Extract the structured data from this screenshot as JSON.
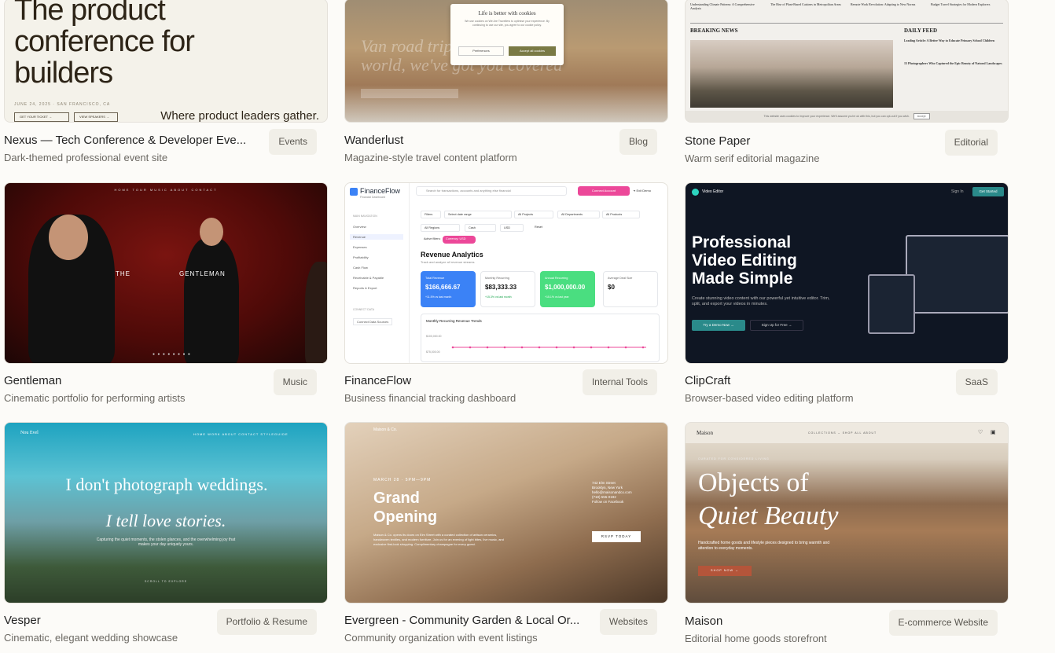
{
  "cards": [
    {
      "title": "Nexus — Tech Conference & Developer Eve...",
      "desc": "Dark-themed professional event site",
      "tag": "Events"
    },
    {
      "title": "Wanderlust",
      "desc": "Magazine-style travel content platform",
      "tag": "Blog"
    },
    {
      "title": "Stone Paper",
      "desc": "Warm serif editorial magazine",
      "tag": "Editorial"
    },
    {
      "title": "Gentleman",
      "desc": "Cinematic portfolio for performing artists",
      "tag": "Music"
    },
    {
      "title": "FinanceFlow",
      "desc": "Business financial tracking dashboard",
      "tag": "Internal Tools"
    },
    {
      "title": "ClipCraft",
      "desc": "Browser-based video editing platform",
      "tag": "SaaS"
    },
    {
      "title": "Vesper",
      "desc": "Cinematic, elegant wedding showcase",
      "tag": "Portfolio & Resume"
    },
    {
      "title": "Evergreen - Community Garden & Local Or...",
      "desc": "Community organization with event listings",
      "tag": "Websites"
    },
    {
      "title": "Maison",
      "desc": "Editorial home goods storefront",
      "tag": "E-commerce Website"
    }
  ],
  "nexus": {
    "headline": "The product conference for builders",
    "subline": "JUNE 24, 2025 · SAN FRANCISCO, CA",
    "btn_ticket": "GET YOUR TICKET →",
    "btn_speakers": "VIEW SPEAKERS →",
    "tagline": "Where product leaders gather."
  },
  "wanderlust": {
    "bg_text": "Van road trips\nworld, we've got you covered",
    "cookie_title": "Life is better with cookies",
    "cookie_body": "We use cookies on We Are Travellers to optimise your experience. By continuing to use our site, you agree to our cookie policy.",
    "cookie_pref": "Preferences",
    "cookie_accept": "Accept all cookies"
  },
  "stonepaper": {
    "top_news": [
      "Understanding Climate Patterns: A Comprehensive Analysis",
      "The Rise of Plant-Based Cuisines in Metropolitan Areas",
      "Remote Work Revolution: Adapting to New Norms",
      "Budget Travel Strategies for Modern Explorers"
    ],
    "breaking": "BREAKING NEWS",
    "daily": "DAILY FEED",
    "feed1": "Leading Article: A Better Way to Educate Primary School Children",
    "feed2": "15 Photographers Who Captured the Epic Beauty of Natural Landscapes",
    "cookie": "This website uses cookies to improve your experience. We'll assume you're ok with this, but you can opt-out if you wish.",
    "accept": "Accept"
  },
  "gentleman": {
    "nav": "HOME   TOUR   MUSIC   ABOUT   CONTACT",
    "word1": "THE",
    "word2": "GENTLEMAN",
    "dots": "● ● ● ● ● ● ● ●"
  },
  "financeflow": {
    "brand": "FinanceFlow",
    "brand_sub": "Financial Dashboard",
    "search_placeholder": "Search for transactions, accounts and anything else financial",
    "connect": "Connect Account",
    "exit": "⇥ Exit Demo",
    "nav_header": "MAIN NAVIGATION",
    "nav": [
      "Overview",
      "Revenue",
      "Expenses",
      "Profitability",
      "Cash Flow",
      "Receivable & Payable",
      "Reports & Export"
    ],
    "connect_header": "CONNECT DATA",
    "connect_sources": "Connect Data Sources",
    "filters": [
      "Filters",
      "Select date range",
      "All Projects",
      "All Departments",
      "All Products",
      "All Regions",
      "Cash",
      "USD",
      "Reset",
      "Active filters:",
      "Currency: USD"
    ],
    "section_title": "Revenue Analytics",
    "section_sub": "Track and analyze all revenue streams",
    "kpis": [
      {
        "label": "Total Revenue",
        "value": "$166,666.67",
        "change": "+11.5% vs last month"
      },
      {
        "label": "Monthly Recurring",
        "value": "$83,333.33",
        "change": "+15.3% vs last month"
      },
      {
        "label": "Annual Recurring",
        "value": "$1,000,000.00",
        "change": "+15.1% vs last year"
      },
      {
        "label": "Average Deal Size",
        "value": "$0",
        "change": ""
      }
    ],
    "chart_title": "Monthly Recurring Revenue Trends",
    "y1": "$100,000.00",
    "y2": "$75,000.00"
  },
  "clipcraft": {
    "brand": "Video Editor",
    "signin": "Sign In",
    "get_started": "Get Started",
    "headline": "Professional Video Editing Made Simple",
    "sub": "Create stunning video content with our powerful yet intuitive editor. Trim, split, and export your videos in minutes.",
    "demo": "Try a Demo Now →",
    "signup": "Sign Up for Free →"
  },
  "vesper": {
    "brand": "Nou Evel",
    "nav": "HOME   WORK   ABOUT   CONTACT   STYLEGUIDE",
    "line1": "I don't photograph weddings.",
    "line2": "I tell love stories.",
    "sub": "Capturing the quiet moments, the stolen glances, and the overwhelming joy that makes your day uniquely yours.",
    "scroll": "SCROLL TO EXPLORE"
  },
  "evergreen": {
    "brand": "Maison & Co.",
    "date": "MARCH 28 · 5PM—9PM",
    "headline": "Grand Opening",
    "body": "Maison & Co. opens its doors on Elm Street with a curated collection of artisan ceramics, handwoven textiles, and modern furniture. Join us for an evening of light bites, live music, and exclusive first-look shopping. Complimentary champagne for every guest.",
    "address": "742 Elm Street\nBrooklyn, New York\nhello@maisonandco.com\n(718) 555-0192\nFollow on Facebook",
    "rsvp": "RSVP TODAY"
  },
  "maison": {
    "brand": "Maison",
    "nav": "COLLECTIONS ⌄    SHOP ALL    ABOUT",
    "curated": "CURATED FOR CONSIDERED LIVING",
    "h1": "Objects of",
    "h2": "Quiet Beauty",
    "sub": "Handcrafted home goods and lifestyle pieces designed to bring warmth and attention to everyday moments.",
    "shop": "SHOP NOW →"
  }
}
